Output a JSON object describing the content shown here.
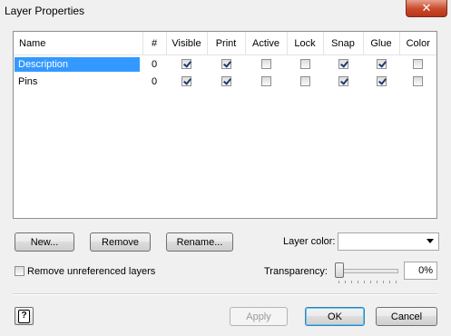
{
  "window": {
    "title": "Layer Properties",
    "close_glyph": "✕"
  },
  "table": {
    "headers": [
      "Name",
      "#",
      "Visible",
      "Print",
      "Active",
      "Lock",
      "Snap",
      "Glue",
      "Color"
    ],
    "rows": [
      {
        "name": "Description",
        "count": "0",
        "selected": true,
        "visible": true,
        "print": true,
        "active": false,
        "lock": false,
        "snap": true,
        "glue": true,
        "color": false
      },
      {
        "name": "Pins",
        "count": "0",
        "selected": false,
        "visible": true,
        "print": true,
        "active": false,
        "lock": false,
        "snap": true,
        "glue": true,
        "color": false
      }
    ]
  },
  "buttons": {
    "new": "New...",
    "remove": "Remove",
    "rename": "Rename...",
    "apply": "Apply",
    "ok": "OK",
    "cancel": "Cancel"
  },
  "layer_color": {
    "label": "Layer color:",
    "value": ""
  },
  "remove_unreferenced": {
    "label": "Remove unreferenced layers",
    "checked": false
  },
  "transparency": {
    "label": "Transparency:",
    "value": "0%",
    "level": 0
  },
  "help": {
    "glyph": "?"
  },
  "colors": {
    "selection": "#3399ff",
    "close": "#c9492a",
    "dialog_bg": "#f0f0f0"
  }
}
